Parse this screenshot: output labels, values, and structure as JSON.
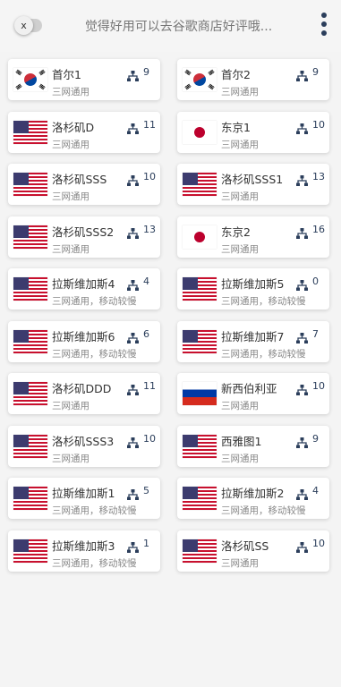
{
  "header": {
    "toggle_label": "x",
    "title": "觉得好用可以去谷歌商店好评哦..."
  },
  "servers": [
    {
      "name": "首尔1",
      "desc": "三网通用",
      "count": "9",
      "flag": "kr-flag"
    },
    {
      "name": "首尔2",
      "desc": "三网通用",
      "count": "9",
      "flag": "kr-flag"
    },
    {
      "name": "洛杉矶D",
      "desc": "三网通用",
      "count": "11",
      "flag": "us-flag"
    },
    {
      "name": "东京1",
      "desc": "三网通用",
      "count": "10",
      "flag": "jp-flag"
    },
    {
      "name": "洛杉矶SSS",
      "desc": "三网通用",
      "count": "10",
      "flag": "us-flag"
    },
    {
      "name": "洛杉矶SSS1",
      "desc": "三网通用",
      "count": "13",
      "flag": "us-flag"
    },
    {
      "name": "洛杉矶SSS2",
      "desc": "三网通用",
      "count": "13",
      "flag": "us-flag"
    },
    {
      "name": "东京2",
      "desc": "三网通用",
      "count": "16",
      "flag": "jp-flag"
    },
    {
      "name": "拉斯维加斯4",
      "desc": "三网通用，移动较慢",
      "count": "4",
      "flag": "us-flag"
    },
    {
      "name": "拉斯维加斯5",
      "desc": "三网通用，移动较慢",
      "count": "0",
      "flag": "us-flag"
    },
    {
      "name": "拉斯维加斯6",
      "desc": "三网通用，移动较慢",
      "count": "6",
      "flag": "us-flag"
    },
    {
      "name": "拉斯维加斯7",
      "desc": "三网通用，移动较慢",
      "count": "7",
      "flag": "us-flag"
    },
    {
      "name": "洛杉矶DDD",
      "desc": "三网通用",
      "count": "11",
      "flag": "us-flag"
    },
    {
      "name": "新西伯利亚",
      "desc": "三网通用",
      "count": "10",
      "flag": "ru-flag"
    },
    {
      "name": "洛杉矶SSS3",
      "desc": "三网通用",
      "count": "10",
      "flag": "us-flag"
    },
    {
      "name": "西雅图1",
      "desc": "三网通用",
      "count": "9",
      "flag": "us-flag"
    },
    {
      "name": "拉斯维加斯1",
      "desc": "三网通用，移动较慢",
      "count": "5",
      "flag": "us-flag"
    },
    {
      "name": "拉斯维加斯2",
      "desc": "三网通用，移动较慢",
      "count": "4",
      "flag": "us-flag"
    },
    {
      "name": "拉斯维加斯3",
      "desc": "三网通用，移动较慢",
      "count": "1",
      "flag": "us-flag"
    },
    {
      "name": "洛杉矶SS",
      "desc": "三网通用",
      "count": "10",
      "flag": "us-flag"
    }
  ],
  "icons": {
    "network": "network-icon",
    "menu": "more-vertical-icon"
  },
  "colors": {
    "accent": "#2b3e5b",
    "text": "#333333",
    "muted": "#888888"
  }
}
